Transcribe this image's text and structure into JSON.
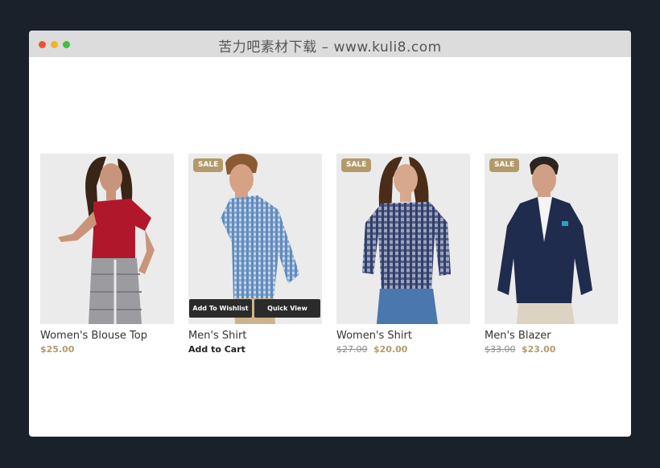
{
  "window": {
    "title": "苦力吧素材下载 – www.kuli8.com"
  },
  "colors": {
    "page_background": "#1a212a",
    "accent_gold": "#b49a6a",
    "button_dark": "#2b2b2b"
  },
  "products": [
    {
      "name": "Women's Blouse Top",
      "price": "$25.00",
      "image_icon": "woman-red-blouse-photo"
    },
    {
      "name": "Men's Shirt",
      "badge": "SALE",
      "add_to_wishlist": "Add To Wishlist",
      "quick_view": "Quick View",
      "add_to_cart": "Add to Cart",
      "image_icon": "man-blue-shirt-photo"
    },
    {
      "name": "Women's Shirt",
      "badge": "SALE",
      "old_price": "$27.00",
      "price": "$20.00",
      "image_icon": "woman-plaid-shirt-photo"
    },
    {
      "name": "Men's Blazer",
      "badge": "SALE",
      "old_price": "$33.00",
      "price": "$23.00",
      "image_icon": "man-navy-blazer-photo"
    }
  ]
}
